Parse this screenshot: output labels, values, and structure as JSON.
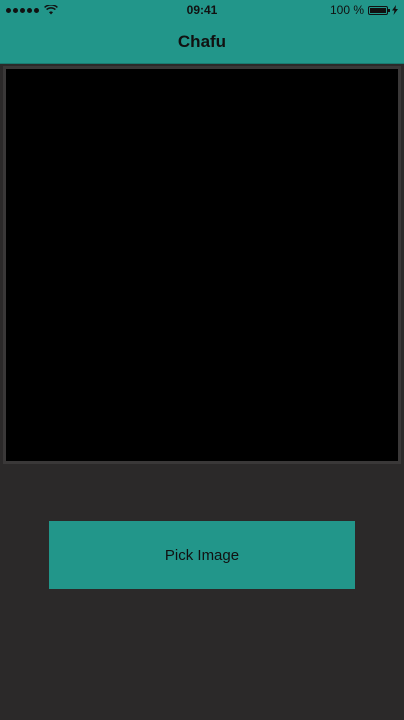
{
  "status_bar": {
    "time": "09:41",
    "battery_percent": "100 %",
    "battery_level": 1.0,
    "icons": [
      "signal-dots-icon",
      "wifi-icon",
      "battery-icon",
      "charging-bolt-icon"
    ]
  },
  "nav": {
    "title": "Chafu"
  },
  "image_view": {
    "empty": true
  },
  "actions": {
    "pick_image_label": "Pick Image"
  },
  "colors": {
    "accent": "#22968a",
    "background": "#2b2929",
    "image_background": "#000000",
    "text": "#111111"
  }
}
